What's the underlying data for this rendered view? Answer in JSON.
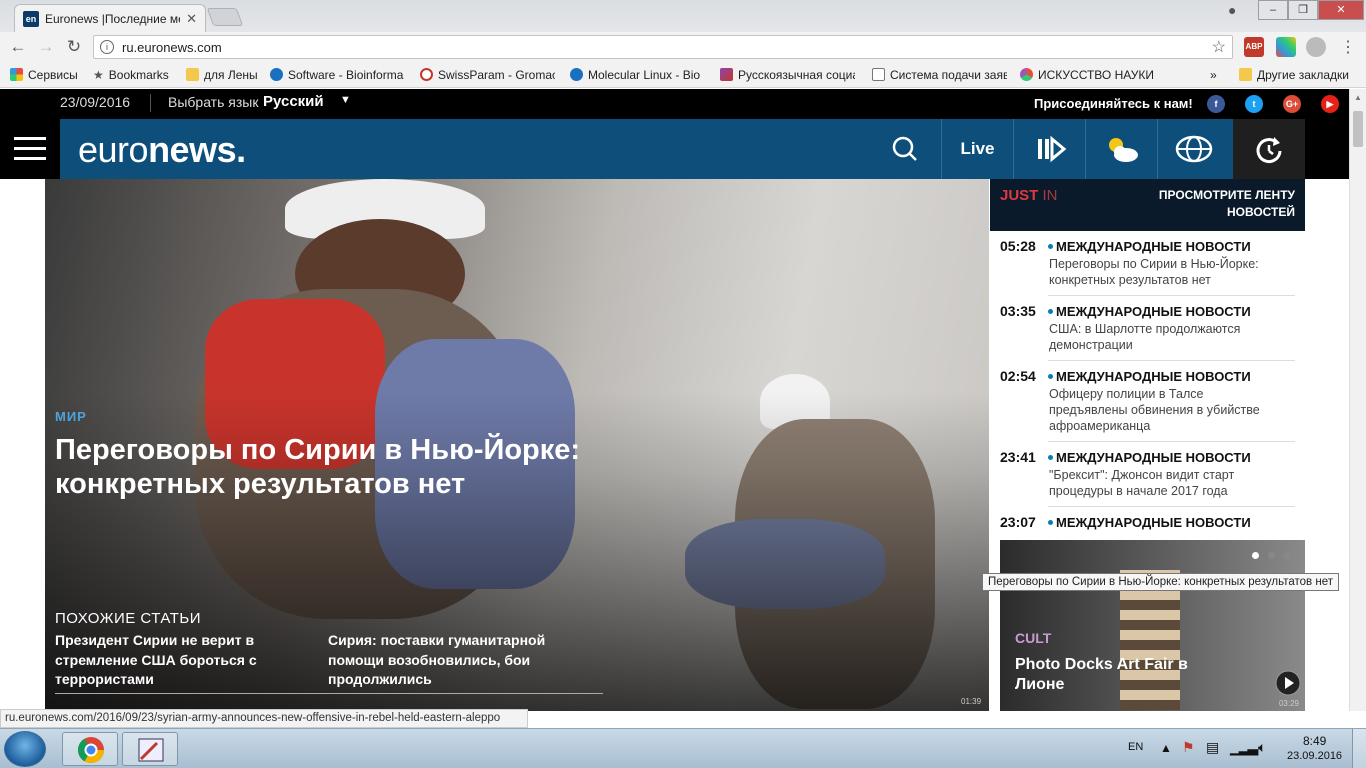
{
  "browser": {
    "tab_title": "Euronews |Последние ме",
    "tab_favicon": "en",
    "url": "ru.euronews.com",
    "bookmarks": [
      "Сервисы",
      "Bookmarks",
      "для Лены",
      "Software - Bioinforma",
      "SwissParam - Gromac",
      "Molecular Linux - Bio",
      "Русскоязычная социа",
      "Система подачи заяв",
      "ИСКУССТВО НАУКИ"
    ],
    "bookmarks_overflow": "»",
    "other_bookmarks": "Другие закладки"
  },
  "site": {
    "date": "23/09/2016",
    "lang_label": "Выбрать язык",
    "lang_value": "Русский",
    "join": "Присоединяйтесь к нам!",
    "logo_light": "euro",
    "logo_bold": "news.",
    "live": "Live"
  },
  "hero": {
    "kicker": "МИР",
    "headline": "Переговоры по Сирии в Нью-Йорке: конкретных результатов нет",
    "related_title": "ПОХОЖИЕ СТАТЬИ",
    "related": [
      "Президент Сирии не верит в стремление США бороться с террористами",
      "Сирия: поставки гуманитарной помощи возобновились, бои продолжились"
    ],
    "video_duration": "01:39"
  },
  "just_in": {
    "label_just": "JUST",
    "label_in": "IN",
    "link": "ПРОСМОТРИТЕ ЛЕНТУ НОВОСТЕЙ",
    "items": [
      {
        "time": "05:28",
        "category": "МЕЖДУНАРОДНЫЕ НОВОСТИ",
        "text": "Переговоры по Сирии в Нью-Йорке: конкретных результатов нет"
      },
      {
        "time": "03:35",
        "category": "МЕЖДУНАРОДНЫЕ НОВОСТИ",
        "text": "США: в Шарлотте продолжаются демонстрации"
      },
      {
        "time": "02:54",
        "category": "МЕЖДУНАРОДНЫЕ НОВОСТИ",
        "text": "Офицеру полиции в Талсе предъявлены обвинения в убийстве афроамериканца"
      },
      {
        "time": "23:41",
        "category": "МЕЖДУНАРОДНЫЕ НОВОСТИ",
        "text": "\"Брексит\": Джонсон видит старт процедуры в начале 2017 года"
      },
      {
        "time": "23:07",
        "category": "МЕЖДУНАРОДНЫЕ НОВОСТИ",
        "text": ""
      }
    ]
  },
  "card": {
    "kicker": "CULT",
    "title": "Photo Docks Art Fair в Лионе",
    "duration": "03:29"
  },
  "tooltip": "Переговоры по Сирии в Нью-Йорке: конкретных результатов нет",
  "status_url": "ru.euronews.com/2016/09/23/syrian-army-announces-new-offensive-in-rebel-held-eastern-aleppo",
  "taskbar": {
    "lang": "EN",
    "time": "8:49",
    "date": "23.09.2016"
  },
  "colors": {
    "brand_blue": "#0d4f7a",
    "just_red": "#e0383e",
    "kicker_blue": "#4fa3db",
    "cult_purple": "#c89bd4"
  }
}
